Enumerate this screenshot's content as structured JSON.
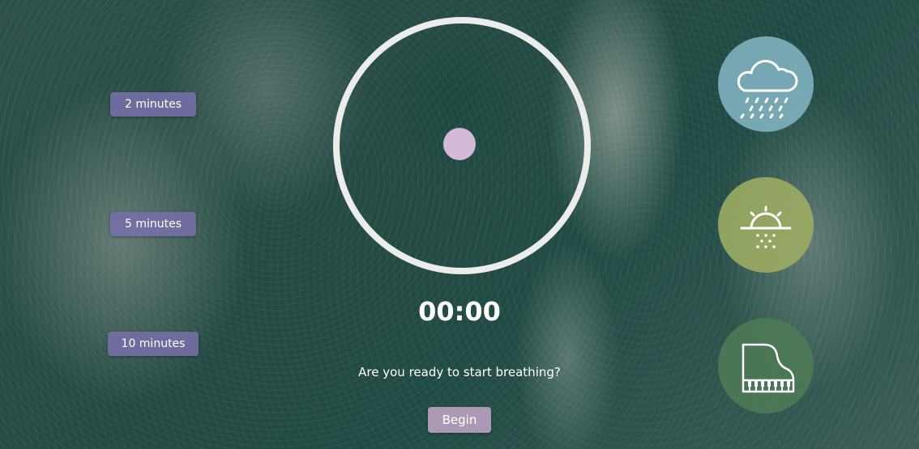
{
  "durations": [
    {
      "label": "2 minutes"
    },
    {
      "label": "5 minutes"
    },
    {
      "label": "10 minutes"
    }
  ],
  "timer": {
    "display": "00:00"
  },
  "prompt": "Are you ready to start breathing?",
  "begin_label": "Begin",
  "sounds": [
    {
      "icon": "rain-cloud-icon",
      "color": "#7fb1bf"
    },
    {
      "icon": "sunset-icon",
      "color": "#9cac63"
    },
    {
      "icon": "piano-icon",
      "color": "#4c7a55"
    }
  ],
  "colors": {
    "duration_button": "#7670a8",
    "breath_dot": "#d4b9d8",
    "begin_button": "#b7a0be",
    "ring": "#ececec"
  }
}
